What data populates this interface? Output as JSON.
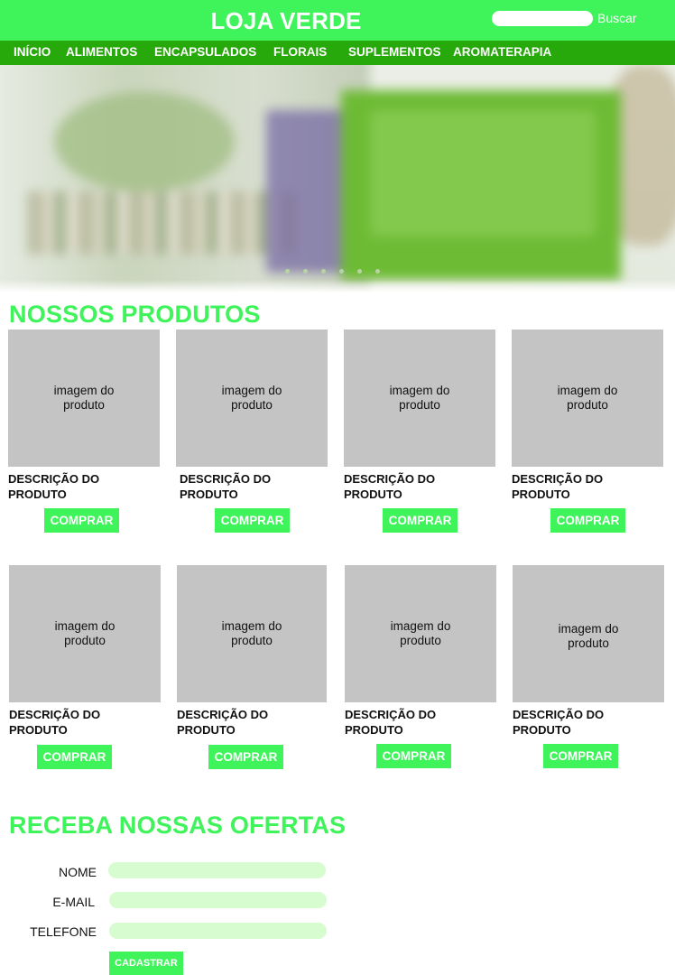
{
  "header": {
    "brand": "LOJA VERDE",
    "search_placeholder": "",
    "search_button": "Buscar"
  },
  "nav": {
    "items": [
      {
        "label": "INÍCIO"
      },
      {
        "label": "ALIMENTOS"
      },
      {
        "label": "ENCAPSULADOS"
      },
      {
        "label": "FLORAIS"
      },
      {
        "label": "SUPLEMENTOS"
      },
      {
        "label": "AROMATERAPIA"
      }
    ]
  },
  "banner": {
    "slide_count": 6
  },
  "products": {
    "title": "NOSSOS PRODUTOS",
    "items": [
      {
        "image_label": "imagem do produto",
        "description": "DESCRIÇÃO DO PRODUTO",
        "button": "COMPRAR"
      },
      {
        "image_label": "imagem do produto",
        "description": "DESCRIÇÃO DO PRODUTO",
        "button": "COMPRAR"
      },
      {
        "image_label": "imagem do produto",
        "description": "DESCRIÇÃO DO PRODUTO",
        "button": "COMPRAR"
      },
      {
        "image_label": "imagem do produto",
        "description": "DESCRIÇÃO DO PRODUTO",
        "button": "COMPRAR"
      },
      {
        "image_label": "imagem do produto",
        "description": "DESCRIÇÃO DO PRODUTO",
        "button": "COMPRAR"
      },
      {
        "image_label": "imagem do produto",
        "description": "DESCRIÇÃO DO PRODUTO",
        "button": "COMPRAR"
      },
      {
        "image_label": "imagem do produto",
        "description": "DESCRIÇÃO DO PRODUTO",
        "button": "COMPRAR"
      },
      {
        "image_label": "imagem do produto",
        "description": "DESCRIÇÃO DO PRODUTO",
        "button": "COMPRAR"
      }
    ]
  },
  "newsletter": {
    "title": "RECEBA NOSSAS OFERTAS",
    "name_label": "NOME",
    "email_label": "E-MAIL",
    "phone_label": "TELEFONE",
    "name_value": "",
    "email_value": "",
    "phone_value": "",
    "submit": "CADASTRAR"
  },
  "colors": {
    "primary_green": "#3ff35a",
    "nav_green": "#27a90b",
    "placeholder_gray": "#c4c4c4",
    "input_green": "#d7fcd0"
  }
}
